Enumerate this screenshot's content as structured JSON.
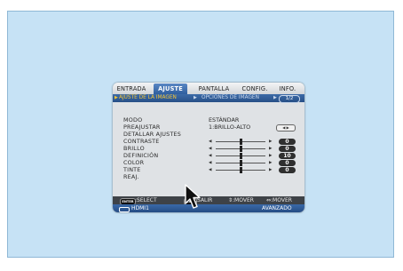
{
  "tabs": [
    {
      "label": "ENTRADA",
      "active": false
    },
    {
      "label": "AJUSTE",
      "active": true
    },
    {
      "label": "PANTALLA",
      "active": false
    },
    {
      "label": "CONFIG.",
      "active": false
    },
    {
      "label": "INFO.",
      "active": false
    }
  ],
  "subtabs": {
    "active": "AJUSTE DE LA IMAGEN",
    "other": "OPCIONES DE IMAGEN",
    "page": "1/2"
  },
  "settings": [
    {
      "label": "MODO",
      "value": "ESTÁNDAR"
    },
    {
      "label": "PREAJUSTAR",
      "value": "1:BRILLO-ALTO"
    },
    {
      "label": "DETALLAR AJUSTES",
      "value": ""
    }
  ],
  "sliders": [
    {
      "label": "CONTRASTE",
      "value": "0",
      "position": 0.5
    },
    {
      "label": "BRILLO",
      "value": "0",
      "position": 0.5
    },
    {
      "label": "DEFINICIÓN",
      "value": "10",
      "position": 0.5
    },
    {
      "label": "COLOR",
      "value": "0",
      "position": 0.5
    },
    {
      "label": "TINTE",
      "value": "0",
      "position": 0.5
    }
  ],
  "reset": {
    "label": "REAJ."
  },
  "footer": {
    "enter_key": "ENTER",
    "select": ":SELECT",
    "exit_key": "EXIT",
    "exit": ":SALIR",
    "move_v": "⇕:MOVER",
    "move_h": "⇔:MOVER"
  },
  "status": {
    "source": "HDMI1",
    "mode": "AVANZADO"
  },
  "colors": {
    "background": "#c6e2f5",
    "active_tab": "#3c6aa8",
    "subtab_highlight": "#f2c437"
  }
}
